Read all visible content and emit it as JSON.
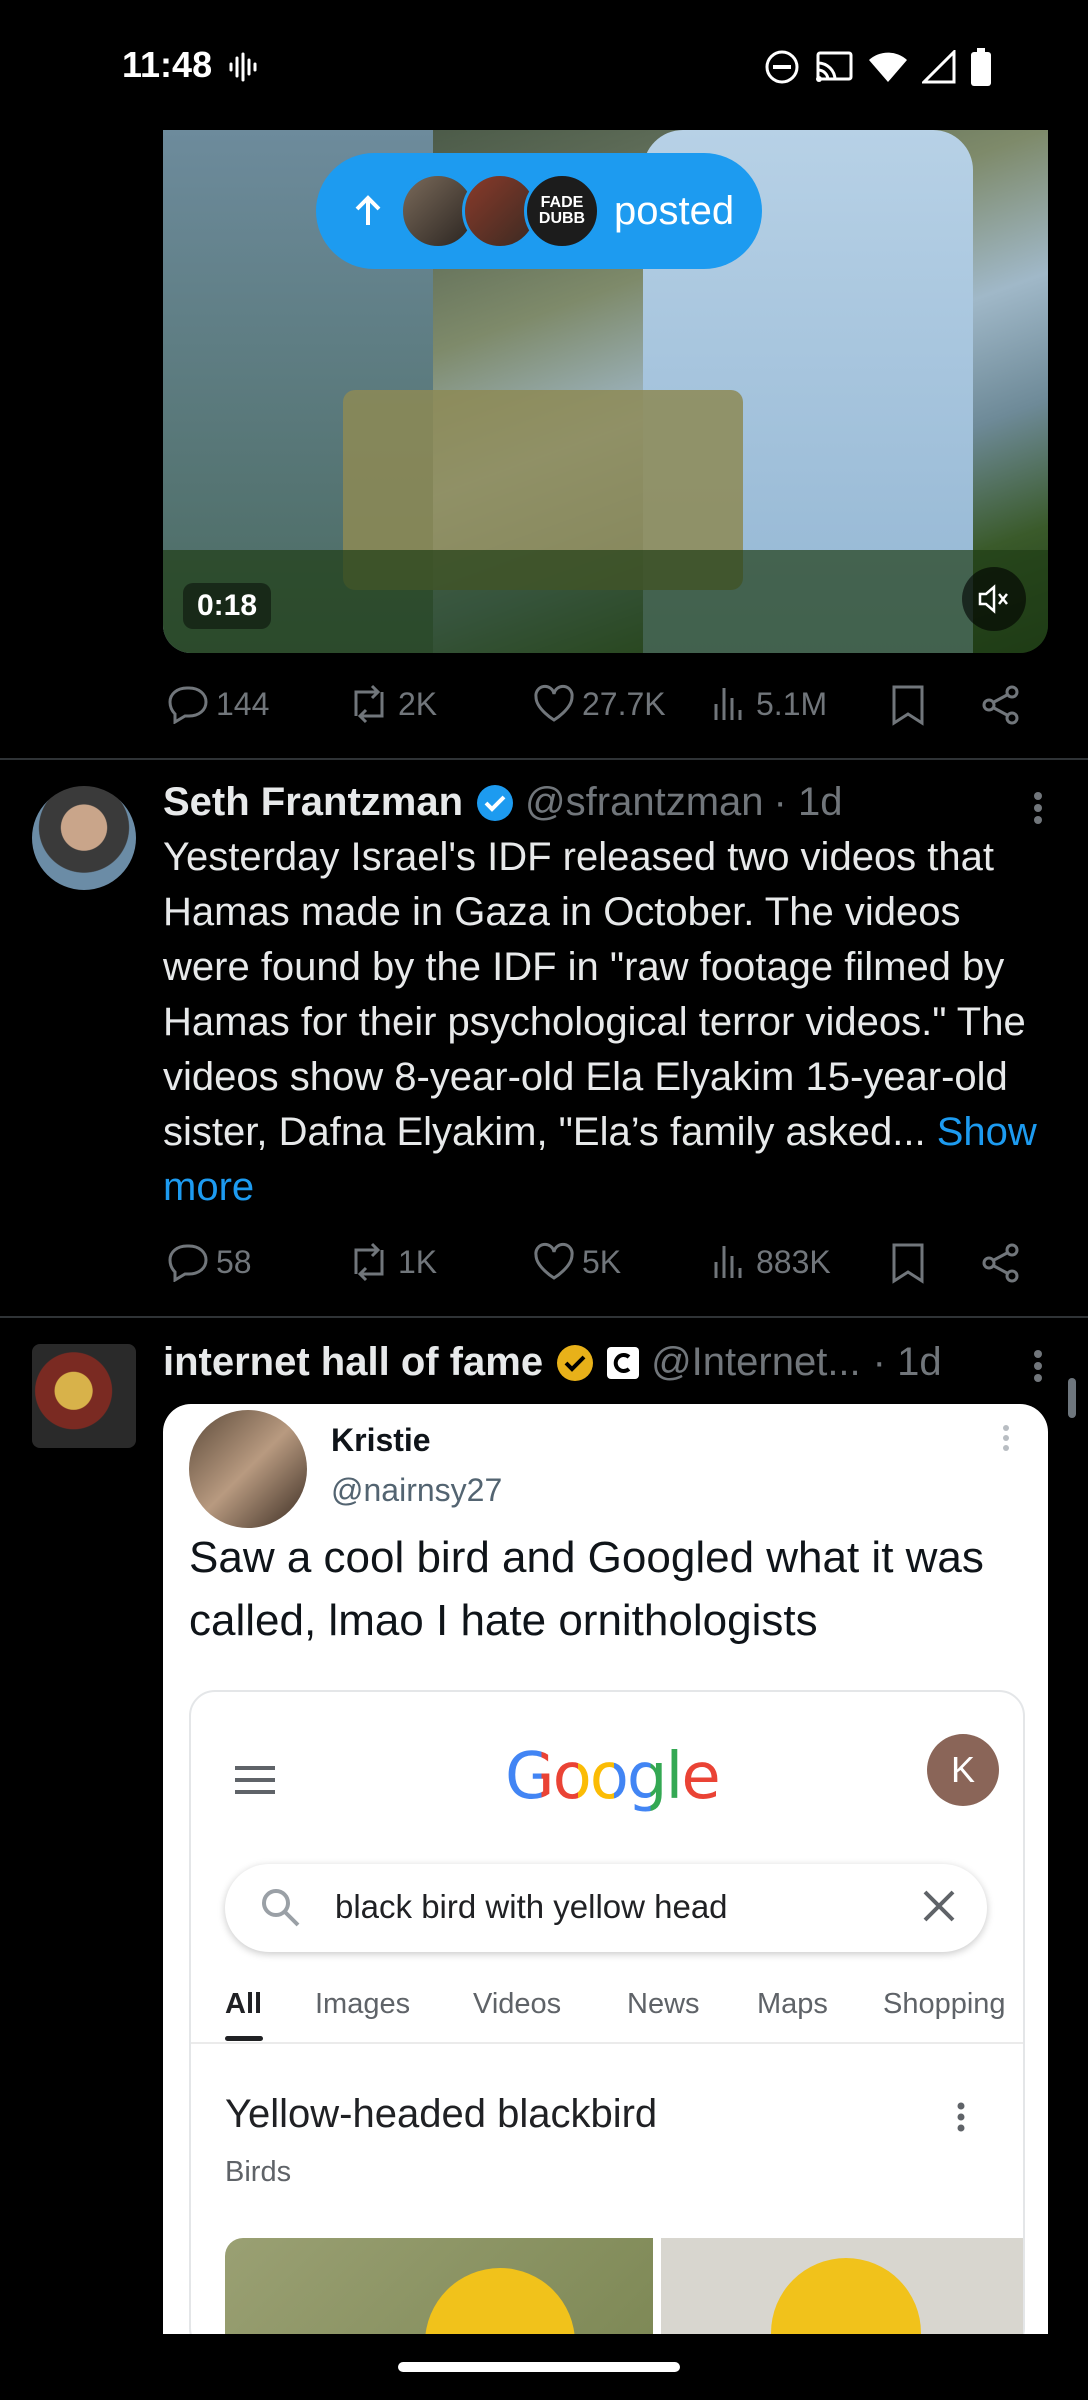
{
  "status_bar": {
    "time": "11:48"
  },
  "video_post": {
    "posted_pill": {
      "label": "posted",
      "avatar_text": "FADE\nDUBB"
    },
    "duration": "0:18",
    "actions": {
      "replies": "144",
      "reposts": "2K",
      "likes": "27.7K",
      "views": "5.1M"
    }
  },
  "tweet1": {
    "name": "Seth Frantzman",
    "handle": "@sfrantzman",
    "time": "· 1d",
    "text": "Yesterday Israel's IDF released two videos that Hamas made in Gaza in October. The videos were found by the IDF in \"raw footage filmed by Hamas for their psychological terror videos.\" The videos show 8-year-old Ela Elyakim  15-year-old sister, Dafna Elyakim, \"Ela’s family asked...",
    "show_more": "Show more",
    "actions": {
      "replies": "58",
      "reposts": "1K",
      "likes": "5K",
      "views": "883K"
    }
  },
  "tweet2": {
    "name": "internet hall of fame",
    "handle": "@Internet...",
    "time": "· 1d",
    "quoted": {
      "name": "Kristie",
      "handle": "@nairnsy27",
      "text": "Saw a cool bird and Googled what it was called, lmao I hate ornithologists",
      "google": {
        "logo": "Google",
        "avatar_letter": "K",
        "search_query": "black bird with yellow head",
        "tabs": [
          "All",
          "Images",
          "Videos",
          "News",
          "Maps",
          "Shopping"
        ],
        "result_title": "Yellow-headed blackbird",
        "result_subtitle": "Birds"
      }
    }
  },
  "colors": {
    "accent": "#1d9bf0",
    "muted": "#71767b",
    "gold_badge": "#e8b119"
  }
}
